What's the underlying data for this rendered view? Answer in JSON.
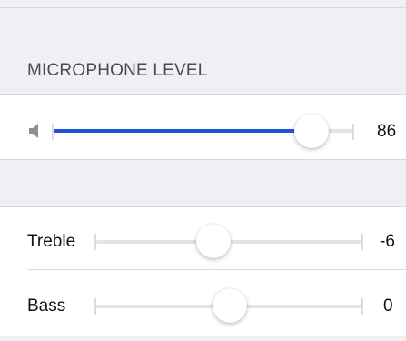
{
  "microphone": {
    "section_title": "MICROPHONE LEVEL",
    "icon": "speaker-icon",
    "level_value": "86",
    "level_fraction": 0.86
  },
  "equalizer": {
    "treble": {
      "label": "Treble",
      "value": "-6",
      "fraction": 0.44
    },
    "bass": {
      "label": "Bass",
      "value": "0",
      "fraction": 0.5
    }
  },
  "colors": {
    "accent": "#1a55d8",
    "background": "#efeff4",
    "track": "#e3e3e8"
  }
}
